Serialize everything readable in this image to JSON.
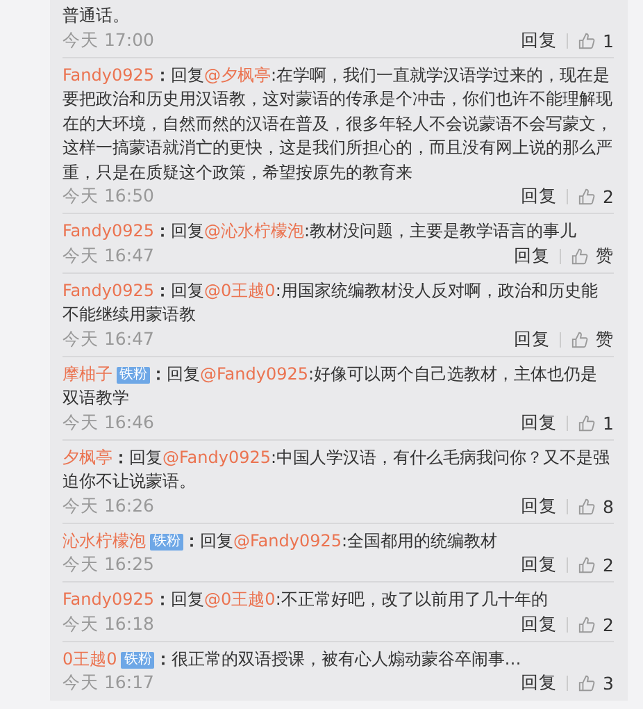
{
  "comments": [
    {
      "text": "普通话。",
      "time": "今天 17:00",
      "reply_label": "回复",
      "likes": "1"
    },
    {
      "user": "Fandy0925",
      "sep": "：",
      "reply_prefix": "回复",
      "reply_to": "@夕枫亭",
      "text": ":在学啊，我们一直就学汉语学过来的，现在是要把政治和历史用汉语教，这对蒙语的传承是个冲击，你们也许不能理解现在的大环境，自然而然的汉语在普及，很多年轻人不会说蒙语不会写蒙文，这样一搞蒙语就消亡的更快，这是我们所担心的，而且没有网上说的那么严重，只是在质疑这个政策，希望按原先的教育来",
      "time": "今天 16:50",
      "reply_label": "回复",
      "likes": "2"
    },
    {
      "user": "Fandy0925",
      "sep": "：",
      "reply_prefix": "回复",
      "reply_to": "@沁水柠檬泡",
      "text": ":教材没问题，主要是教学语言的事儿",
      "time": "今天 16:47",
      "reply_label": "回复",
      "likes": "赞"
    },
    {
      "user": "Fandy0925",
      "sep": "：",
      "reply_prefix": "回复",
      "reply_to": "@0王越0",
      "text": ":用国家统编教材没人反对啊，政治和历史能不能继续用蒙语教",
      "time": "今天 16:47",
      "reply_label": "回复",
      "likes": "赞"
    },
    {
      "user": "摩柚子",
      "badge": "铁粉",
      "sep": "：",
      "reply_prefix": "回复",
      "reply_to": "@Fandy0925",
      "text": ":好像可以两个自己选教材，主体也仍是双语教学",
      "time": "今天 16:46",
      "reply_label": "回复",
      "likes": "1"
    },
    {
      "user": "夕枫亭",
      "sep": "：",
      "reply_prefix": "回复",
      "reply_to": "@Fandy0925",
      "text": ":中国人学汉语，有什么毛病我问你？又不是强迫你不让说蒙语。",
      "time": "今天 16:26",
      "reply_label": "回复",
      "likes": "8"
    },
    {
      "user": "沁水柠檬泡",
      "badge": "铁粉",
      "sep": "：",
      "reply_prefix": "回复",
      "reply_to": "@Fandy0925",
      "text": ":全国都用的统编教材",
      "time": "今天 16:25",
      "reply_label": "回复",
      "likes": "2"
    },
    {
      "user": "Fandy0925",
      "sep": "：",
      "reply_prefix": "回复",
      "reply_to": "@0王越0",
      "text": ":不正常好吧，改了以前用了几十年的",
      "time": "今天 16:18",
      "reply_label": "回复",
      "likes": "2"
    },
    {
      "user": "0王越0",
      "badge": "铁粉",
      "sep": "：",
      "text": "很正常的双语授课，被有心人煽动蒙谷卒闹事…",
      "time": "今天 16:17",
      "reply_label": "回复",
      "likes": "3"
    }
  ]
}
